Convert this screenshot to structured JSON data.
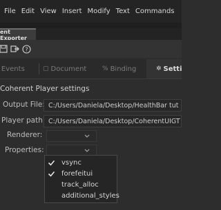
{
  "menu": [
    "File",
    "Edit",
    "View",
    "Insert",
    "Modify",
    "Text",
    "Commands"
  ],
  "panel_title": "ent Exporter",
  "tabs": [
    {
      "label": "Events",
      "icon": "events-icon"
    },
    {
      "label": "Document",
      "icon": "document-icon"
    },
    {
      "label": "Binding",
      "icon": "binding-icon"
    },
    {
      "label": "Settin",
      "icon": "gear-icon",
      "active": true
    }
  ],
  "section_title": "Coherent Player settings",
  "output_file": {
    "label": "Output File:",
    "value": "C:/Users/Daniela/Desktop/HealthBar tut"
  },
  "player_path": {
    "label": "Player path:",
    "value": "C:/Users/Daniela/Desktop/CoherentUIGT"
  },
  "renderer": {
    "label": "Renderer:",
    "value": ""
  },
  "properties": {
    "label": "Properties:",
    "options": [
      {
        "label": "vsync",
        "checked": true
      },
      {
        "label": "forefeitui",
        "checked": true
      },
      {
        "label": "track_alloc",
        "checked": false
      },
      {
        "label": "additional_styles",
        "checked": false
      }
    ]
  },
  "colors": {
    "accent_check": "#e6e6e6",
    "background": "#2d2d2d"
  }
}
